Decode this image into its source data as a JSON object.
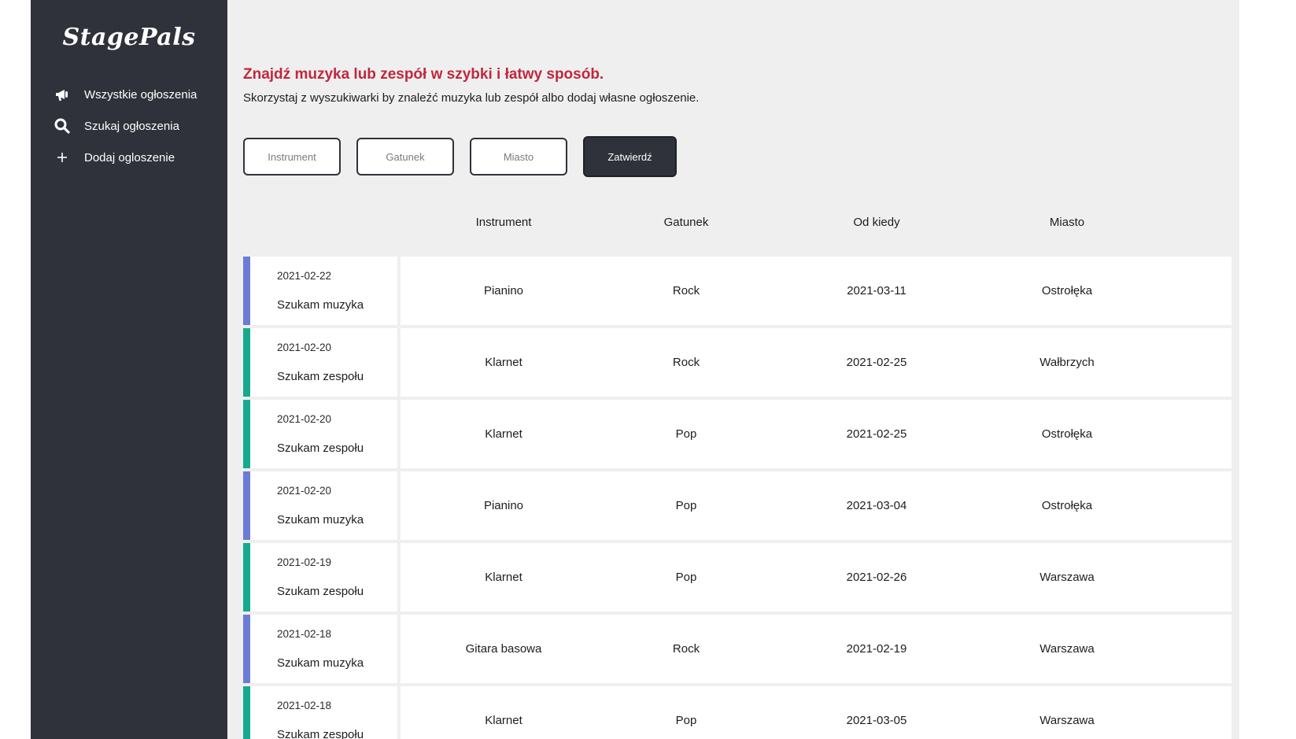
{
  "app": {
    "logo": "StagePals"
  },
  "sidebar": {
    "items": [
      {
        "label": "Wszystkie ogłoszenia",
        "icon": "megaphone-icon"
      },
      {
        "label": "Szukaj ogłoszenia",
        "icon": "search-icon"
      },
      {
        "label": "Dodaj ogloszenie",
        "icon": "plus-icon"
      }
    ]
  },
  "main": {
    "headline": "Znajdź muzyka lub zespół w szybki i łatwy sposób.",
    "subline": "Skorzystaj z wyszukiwarki by znaleźć muzyka lub zespół albo dodaj własne ogłoszenie."
  },
  "search": {
    "instrument_placeholder": "Instrument",
    "genre_placeholder": "Gatunek",
    "city_placeholder": "Miasto",
    "submit_label": "Zatwierdź"
  },
  "table": {
    "headers": [
      "Instrument",
      "Gatunek",
      "Od kiedy",
      "Miasto"
    ],
    "rows": [
      {
        "date": "2021-02-22",
        "title": "Szukam muzyka",
        "instrument": "Pianino",
        "genre": "Rock",
        "since": "2021-03-11",
        "city": "Ostrołęka"
      },
      {
        "date": "2021-02-20",
        "title": "Szukam zespołu",
        "instrument": "Klarnet",
        "genre": "Rock",
        "since": "2021-02-25",
        "city": "Wałbrzych"
      },
      {
        "date": "2021-02-20",
        "title": "Szukam zespołu",
        "instrument": "Klarnet",
        "genre": "Pop",
        "since": "2021-02-25",
        "city": "Ostrołęka"
      },
      {
        "date": "2021-02-20",
        "title": "Szukam muzyka",
        "instrument": "Pianino",
        "genre": "Pop",
        "since": "2021-03-04",
        "city": "Ostrołęka"
      },
      {
        "date": "2021-02-19",
        "title": "Szukam zespołu",
        "instrument": "Klarnet",
        "genre": "Pop",
        "since": "2021-02-26",
        "city": "Warszawa"
      },
      {
        "date": "2021-02-18",
        "title": "Szukam muzyka",
        "instrument": "Gitara basowa",
        "genre": "Rock",
        "since": "2021-02-19",
        "city": "Warszawa"
      },
      {
        "date": "2021-02-18",
        "title": "Szukam zespołu",
        "instrument": "Klarnet",
        "genre": "Pop",
        "since": "2021-03-05",
        "city": "Warszawa"
      }
    ]
  },
  "colors": {
    "sidebar_bg": "#2f323a",
    "main_bg": "#efefef",
    "headline": "#c0283e",
    "musician_accent": "#6b7bd6",
    "band_accent": "#17a990"
  }
}
